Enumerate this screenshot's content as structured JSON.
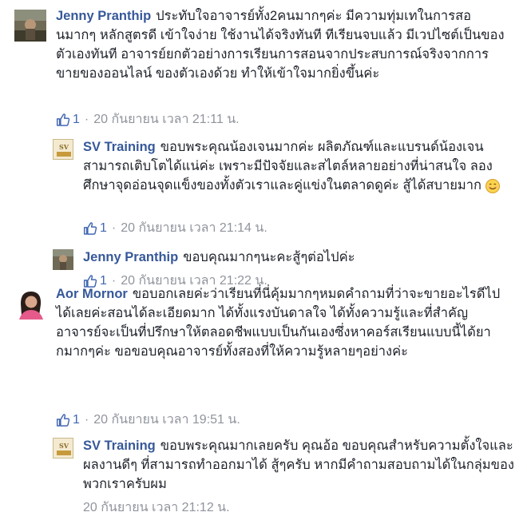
{
  "comments": [
    {
      "author": "Jenny Pranthip",
      "text": "ประทับใจอาจารย์ทั้ง2คนมากๆค่ะ มีความทุ่มเทในการสอนมากๆ หลักสูตรดี เข้าใจง่าย ใช้งานได้จริงทันที ทีเรียนจบแล้ว มีเวปไซต์เป็นของตัวเองทันที อาจารย์ยกตัวอย่างการเรียนการสอนจากประสบการณ์จริงจากการขายของออนไลน์ ของตัวเองด้วย ทำให้เข้าใจมากยิ่งขึ้นค่ะ",
      "likes": "1",
      "timestamp": "20 กันยายน เวลา 21:11 น.",
      "replies": [
        {
          "author": "SV Training",
          "text": "ขอบพระคุณน้องเจนมากค่ะ ผลิตภัณฑ์และแบรนด์น้องเจนสามารถเติบโตได้แน่ค่ะ เพราะมีปัจจัยและสไตล์หลายอย่างที่น่าสนใจ ลองศึกษาจุดอ่อนจุดแข็งของทั้งตัวเราและคู่แข่งในตลาดดูค่ะ สู้ได้สบายมาก",
          "likes": "1",
          "timestamp": "20 กันยายน เวลา 21:14 น."
        },
        {
          "author": "Jenny Pranthip",
          "text": "ขอบคุณมากๆนะคะสู้ๆต่อไปค่ะ",
          "likes": "1",
          "timestamp": "20 กันยายน เวลา 21:22 น."
        }
      ]
    },
    {
      "author": "Aor Mornor",
      "text": "ขอบอกเลยค่ะว่าเรียนที่นี่คุ้มมากๆหมดคำถามที่ว่าจะขายอะไรดีไปได้เลยค่ะสอนได้ละเอียดมาก ได้ทั้งแรงบันดาลใจ ได้ทั้งความรู้และที่สำคัญอาจารย์จะเป็นที่ปรึกษาให้ตลอดชีพแบบเป็นกันเองซึ่งหาคอร์สเรียนแบบนี้ได้ยากมากๆค่ะ ขอขอบคุณอาจารย์ทั้งสองที่ให้ความรู้หลายๆอย่างค่ะ",
      "likes": "1",
      "timestamp": "20 กันยายน เวลา 19:51 น.",
      "replies": [
        {
          "author": "SV Training",
          "text": "ขอบพระคุณมากเลยครับ คุณอ้อ ขอบคุณสำหรับความตั้งใจและผลงานดีๆ ที่สามารถทำออกมาได้ สู้ๆครับ หากมีคำถามสอบถามได้ในกลุ่มของพวกเราครับผม",
          "timestamp": "20 กันยายน เวลา 21:12 น."
        }
      ]
    }
  ],
  "separator": "·",
  "colors": {
    "link": "#365899",
    "meta": "#90949c",
    "like": "#4267b2"
  },
  "icons": {
    "like": "thumbs-up-icon",
    "emoji": "smiling-face-icon"
  }
}
